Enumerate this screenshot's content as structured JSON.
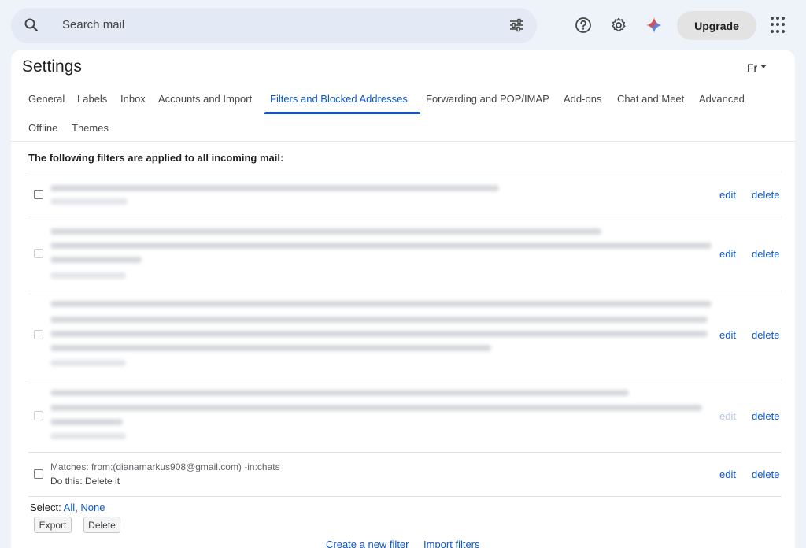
{
  "search": {
    "placeholder": "Search mail"
  },
  "topbar": {
    "upgrade_label": "Upgrade"
  },
  "settings": {
    "title": "Settings",
    "language": "Fr",
    "tabs": [
      "General",
      "Labels",
      "Inbox",
      "Accounts and Import",
      "Filters and Blocked Addresses",
      "Forwarding and POP/IMAP",
      "Add-ons",
      "Chat and Meet",
      "Advanced",
      "Offline",
      "Themes"
    ],
    "active_tab": "Filters and Blocked Addresses"
  },
  "filters": {
    "heading": "The following filters are applied to all incoming mail:",
    "edit_label": "edit",
    "delete_label": "delete",
    "items": [
      {
        "matches": "",
        "action": ""
      },
      {
        "matches": "",
        "action": ""
      },
      {
        "matches": "",
        "action": ""
      },
      {
        "matches": "",
        "action": ""
      },
      {
        "matches": "Matches: from:(dianamarkus908@gmail.com) -in:chats",
        "action": "Do this: Delete it"
      }
    ]
  },
  "select": {
    "label": "Select:",
    "all": "All",
    "none": "None"
  },
  "actions": {
    "export": "Export",
    "delete": "Delete"
  },
  "footer": {
    "create_filter": "Create a new filter",
    "import_filters": "Import filters"
  }
}
